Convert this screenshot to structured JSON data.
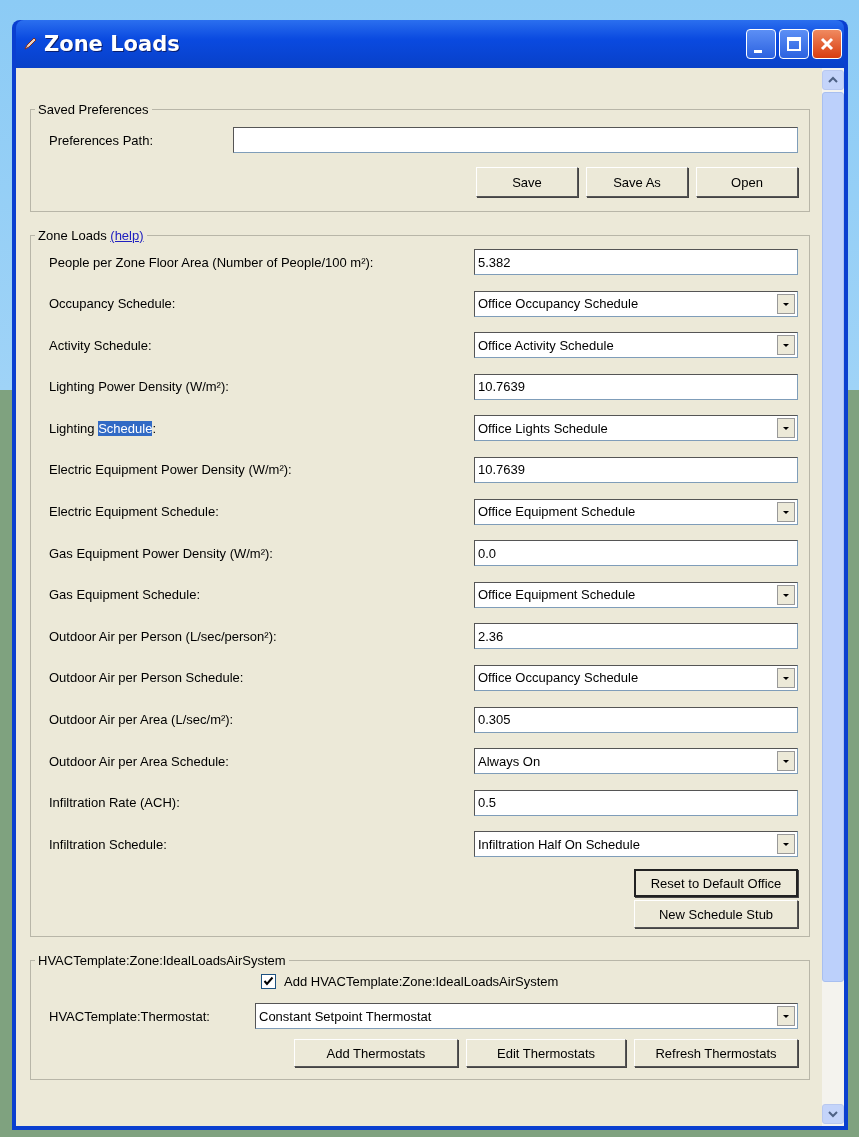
{
  "window": {
    "title": "Zone Loads"
  },
  "saved_preferences": {
    "title": "Saved Preferences",
    "path_label": "Preferences Path:",
    "buttons": [
      {
        "label": "Save"
      },
      {
        "label": "Save As"
      },
      {
        "label": "Open"
      }
    ]
  },
  "zone_loads": {
    "title": "Zone Loads",
    "help_link": "(help)",
    "rows": [
      {
        "kind": "text",
        "label_parts": [
          {
            "text": "People per Zone Floor Area (Number of People/100 m²):",
            "selected": false
          }
        ],
        "value": "5.382"
      },
      {
        "kind": "dropdown",
        "label_parts": [
          {
            "text": "Occupancy Schedule:",
            "selected": false
          }
        ],
        "value": "Office Occupancy Schedule"
      },
      {
        "kind": "dropdown",
        "label_parts": [
          {
            "text": "Activity Schedule:",
            "selected": false
          }
        ],
        "value": "Office Activity Schedule"
      },
      {
        "kind": "text",
        "label_parts": [
          {
            "text": "Lighting Power Density (W/m²):",
            "selected": false
          }
        ],
        "value": "10.7639"
      },
      {
        "kind": "dropdown",
        "label_parts": [
          {
            "text": "Lighting ",
            "selected": false
          },
          {
            "text": "Schedule",
            "selected": true
          },
          {
            "text": ":",
            "selected": false
          }
        ],
        "value": "Office Lights Schedule"
      },
      {
        "kind": "text",
        "label_parts": [
          {
            "text": "Electric Equipment Power Density (W/m²):",
            "selected": false
          }
        ],
        "value": "10.7639"
      },
      {
        "kind": "dropdown",
        "label_parts": [
          {
            "text": "Electric Equipment Schedule:",
            "selected": false
          }
        ],
        "value": "Office Equipment Schedule"
      },
      {
        "kind": "text",
        "label_parts": [
          {
            "text": "Gas Equipment Power Density (W/m²):",
            "selected": false
          }
        ],
        "value": "0.0"
      },
      {
        "kind": "dropdown",
        "label_parts": [
          {
            "text": "Gas Equipment Schedule:",
            "selected": false
          }
        ],
        "value": "Office Equipment Schedule"
      },
      {
        "kind": "text",
        "label_parts": [
          {
            "text": "Outdoor Air per Person (L/sec/person²):",
            "selected": false
          }
        ],
        "value": "2.36"
      },
      {
        "kind": "dropdown",
        "label_parts": [
          {
            "text": "Outdoor Air per Person Schedule:",
            "selected": false
          }
        ],
        "value": "Office Occupancy Schedule"
      },
      {
        "kind": "text",
        "label_parts": [
          {
            "text": "Outdoor Air per Area (L/sec/m²):",
            "selected": false
          }
        ],
        "value": "0.305"
      },
      {
        "kind": "dropdown",
        "label_parts": [
          {
            "text": "Outdoor Air per Area Schedule:",
            "selected": false
          }
        ],
        "value": "Always On"
      },
      {
        "kind": "text",
        "label_parts": [
          {
            "text": "Infiltration Rate (ACH):",
            "selected": false
          }
        ],
        "value": "0.5"
      },
      {
        "kind": "dropdown",
        "label_parts": [
          {
            "text": "Infiltration Schedule:",
            "selected": false
          }
        ],
        "value": "Infiltration Half On Schedule"
      }
    ],
    "buttons": [
      {
        "label": "Reset to Default Office",
        "default": true
      },
      {
        "label": "New Schedule Stub",
        "default": false
      }
    ]
  },
  "hvac": {
    "title": "HVACTemplate:Zone:IdealLoadsAirSystem",
    "checkbox": {
      "label": "Add HVACTemplate:Zone:IdealLoadsAirSystem",
      "checked": true
    },
    "thermostat_label": "HVACTemplate:Thermostat:",
    "thermostat_value": "Constant Setpoint Thermostat",
    "buttons": [
      {
        "label": "Add Thermostats"
      },
      {
        "label": "Edit Thermostats"
      },
      {
        "label": "Refresh Thermostats"
      }
    ]
  }
}
